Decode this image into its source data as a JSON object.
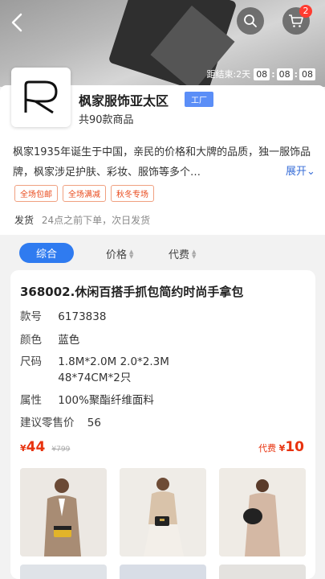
{
  "header": {
    "back_icon": "chevron-left-icon",
    "search_icon": "search-icon",
    "cart_icon": "cart-icon",
    "cart_badge": "2",
    "countdown": {
      "label": "距结束:2天",
      "hours": "08",
      "minutes": "08",
      "seconds": "08"
    }
  },
  "store": {
    "name": "枫家服饰亚太区",
    "tag": "工厂",
    "count": "共90款商品",
    "description": "枫家1935年诞生于中国，亲民的价格和大牌的品质，独一服饰品牌，枫家涉足护肤、彩妆、服饰等多个…",
    "expand_label": "展开",
    "promo_tags": [
      "全场包邮",
      "全场满减",
      "秋冬专场"
    ],
    "shipping_label": "发货",
    "shipping_value": "24点之前下单，次日发货"
  },
  "sort": {
    "active": "综合",
    "price": "价格",
    "fee": "代费"
  },
  "product": {
    "title": "368002.休闲百搭手抓包简约时尚手拿包",
    "attrs": [
      {
        "k": "款号",
        "v": "6173838"
      },
      {
        "k": "颜色",
        "v": "蓝色"
      },
      {
        "k": "尺码",
        "v": "1.8M*2.0M 2.0*2.3M"
      },
      {
        "k": "",
        "v": "48*74CM*2只"
      },
      {
        "k": "属性",
        "v": "100%聚酯纤维面料"
      },
      {
        "k": "建议零售价",
        "v": "56"
      }
    ],
    "price_symbol": "¥",
    "price": "44",
    "orig_price": "¥799",
    "fee_label": "代费",
    "fee_symbol": "¥",
    "fee_value": "10"
  },
  "colors": {
    "accent": "#2f7bf0",
    "price": "#e8330f",
    "badge": "#ff3b30"
  }
}
